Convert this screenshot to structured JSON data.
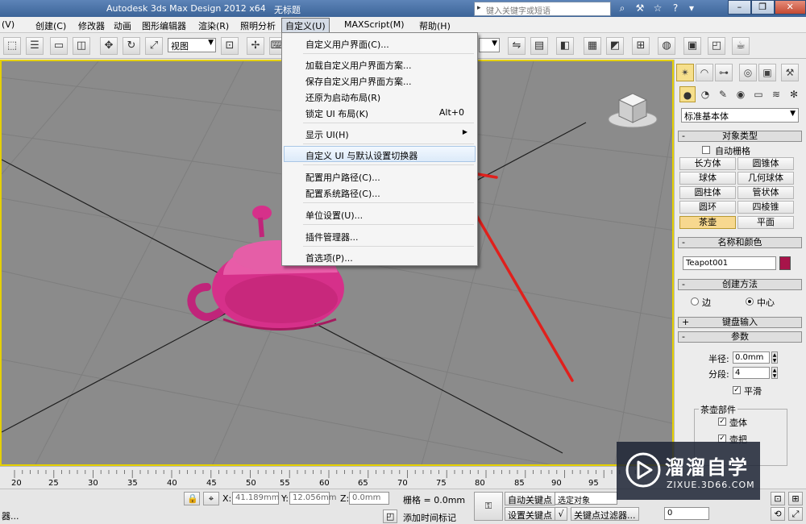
{
  "titlebar": {
    "app_title": "Autodesk 3ds Max Design 2012 x64",
    "doc_title": "无标题",
    "search_placeholder": "键入关键字或短语"
  },
  "menubar": {
    "items": [
      "(V)",
      "创建(C)",
      "修改器",
      "动画",
      "图形编辑器",
      "渲染(R)",
      "照明分析",
      "自定义(U)",
      "MAXScript(M)",
      "帮助(H)"
    ]
  },
  "toolbar": {
    "view_select": "视图"
  },
  "customize_menu": {
    "items": [
      {
        "label": "自定义用户界面(C)...",
        "shortcut": ""
      },
      {
        "label": "加载自定义用户界面方案...",
        "shortcut": ""
      },
      {
        "label": "保存自定义用户界面方案...",
        "shortcut": ""
      },
      {
        "label": "还原为启动布局(R)",
        "shortcut": ""
      },
      {
        "label": "锁定 UI 布局(K)",
        "shortcut": "Alt+0"
      },
      {
        "label": "显示 UI(H)",
        "shortcut": ""
      },
      {
        "label": "自定义 UI 与默认设置切换器",
        "shortcut": ""
      },
      {
        "label": "配置用户路径(C)...",
        "shortcut": ""
      },
      {
        "label": "配置系统路径(C)...",
        "shortcut": ""
      },
      {
        "label": "单位设置(U)...",
        "shortcut": ""
      },
      {
        "label": "插件管理器...",
        "shortcut": ""
      },
      {
        "label": "首选项(P)...",
        "shortcut": ""
      }
    ],
    "highlighted_index": 6
  },
  "command_panel": {
    "category": "标准基本体",
    "object_type": {
      "title": "对象类型",
      "autogrid": "自动栅格",
      "buttons": [
        "长方体",
        "圆锥体",
        "球体",
        "几何球体",
        "圆柱体",
        "管状体",
        "圆环",
        "四棱锥",
        "茶壶",
        "平面"
      ],
      "active": "茶壶"
    },
    "name_color": {
      "title": "名称和颜色",
      "name": "Teapot001",
      "color": "#a8144a"
    },
    "creation_method": {
      "title": "创建方法",
      "edge": "边",
      "center": "中心"
    },
    "keyboard_entry": "键盘输入",
    "parameters": {
      "title": "参数",
      "radius_label": "半径:",
      "radius": "0.0mm",
      "segments_label": "分段:",
      "segments": "4",
      "smooth": "平滑",
      "parts_title": "茶壶部件",
      "body": "壶体",
      "handle": "壶把"
    }
  },
  "timeline": {
    "ticks": [
      "20",
      "25",
      "30",
      "35",
      "40",
      "45",
      "50",
      "55",
      "60",
      "65",
      "70",
      "75",
      "80",
      "85",
      "90",
      "95"
    ]
  },
  "statusbar": {
    "left_text": "器...",
    "x_label": "X:",
    "x_value": "41.189mm",
    "y_label": "Y:",
    "y_value": "12.056mm",
    "z_label": "Z:",
    "z_value": "0.0mm",
    "grid": "栅格 = 0.0mm",
    "add_time_tag": "添加时间标记",
    "auto_key": "自动关键点",
    "set_key": "设置关键点",
    "selected_object": "选定对象",
    "key_filters": "关键点过滤器...",
    "frame": "0"
  },
  "watermark": {
    "brand": "溜溜自学",
    "url": "ZIXUE.3D66.COM"
  },
  "colors": {
    "teapot": "#d6308a",
    "annotation_arrow": "#e0201c",
    "active_button": "#f7d88f",
    "viewport_border": "#e5d000"
  }
}
